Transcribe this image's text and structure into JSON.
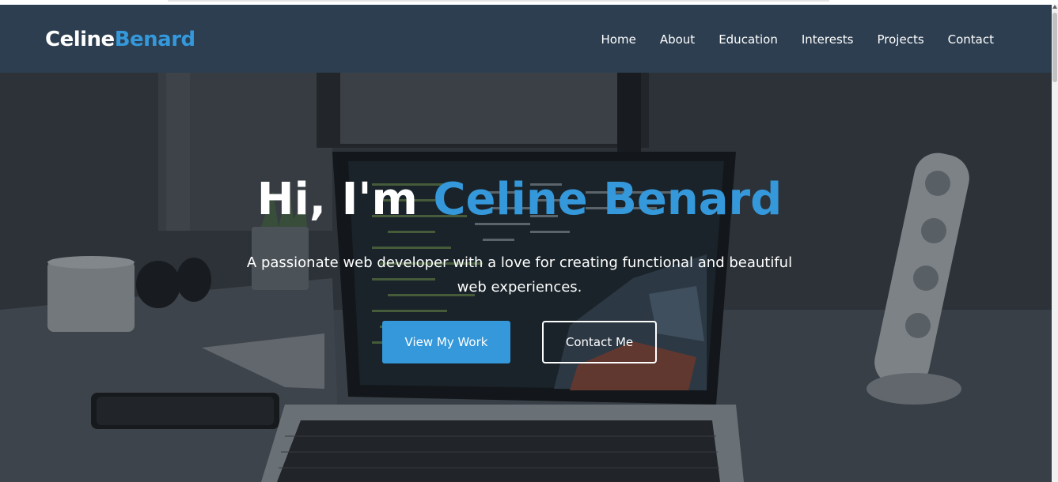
{
  "brand": {
    "first": "Celine",
    "last": "Benard"
  },
  "nav": {
    "items": [
      {
        "label": "Home"
      },
      {
        "label": "About"
      },
      {
        "label": "Education"
      },
      {
        "label": "Interests"
      },
      {
        "label": "Projects"
      },
      {
        "label": "Contact"
      }
    ]
  },
  "hero": {
    "greeting": "Hi, I'm ",
    "name": "Celine Benard",
    "subtitle": "A passionate web developer with a love for creating functional and beautiful web experiences.",
    "primary_button": "View My Work",
    "secondary_button": "Contact Me",
    "background_image": "desk-laptop-workspace-photo"
  },
  "colors": {
    "navbar": "#2c3e50",
    "accent": "#3498db",
    "text_light": "#ffffff"
  }
}
